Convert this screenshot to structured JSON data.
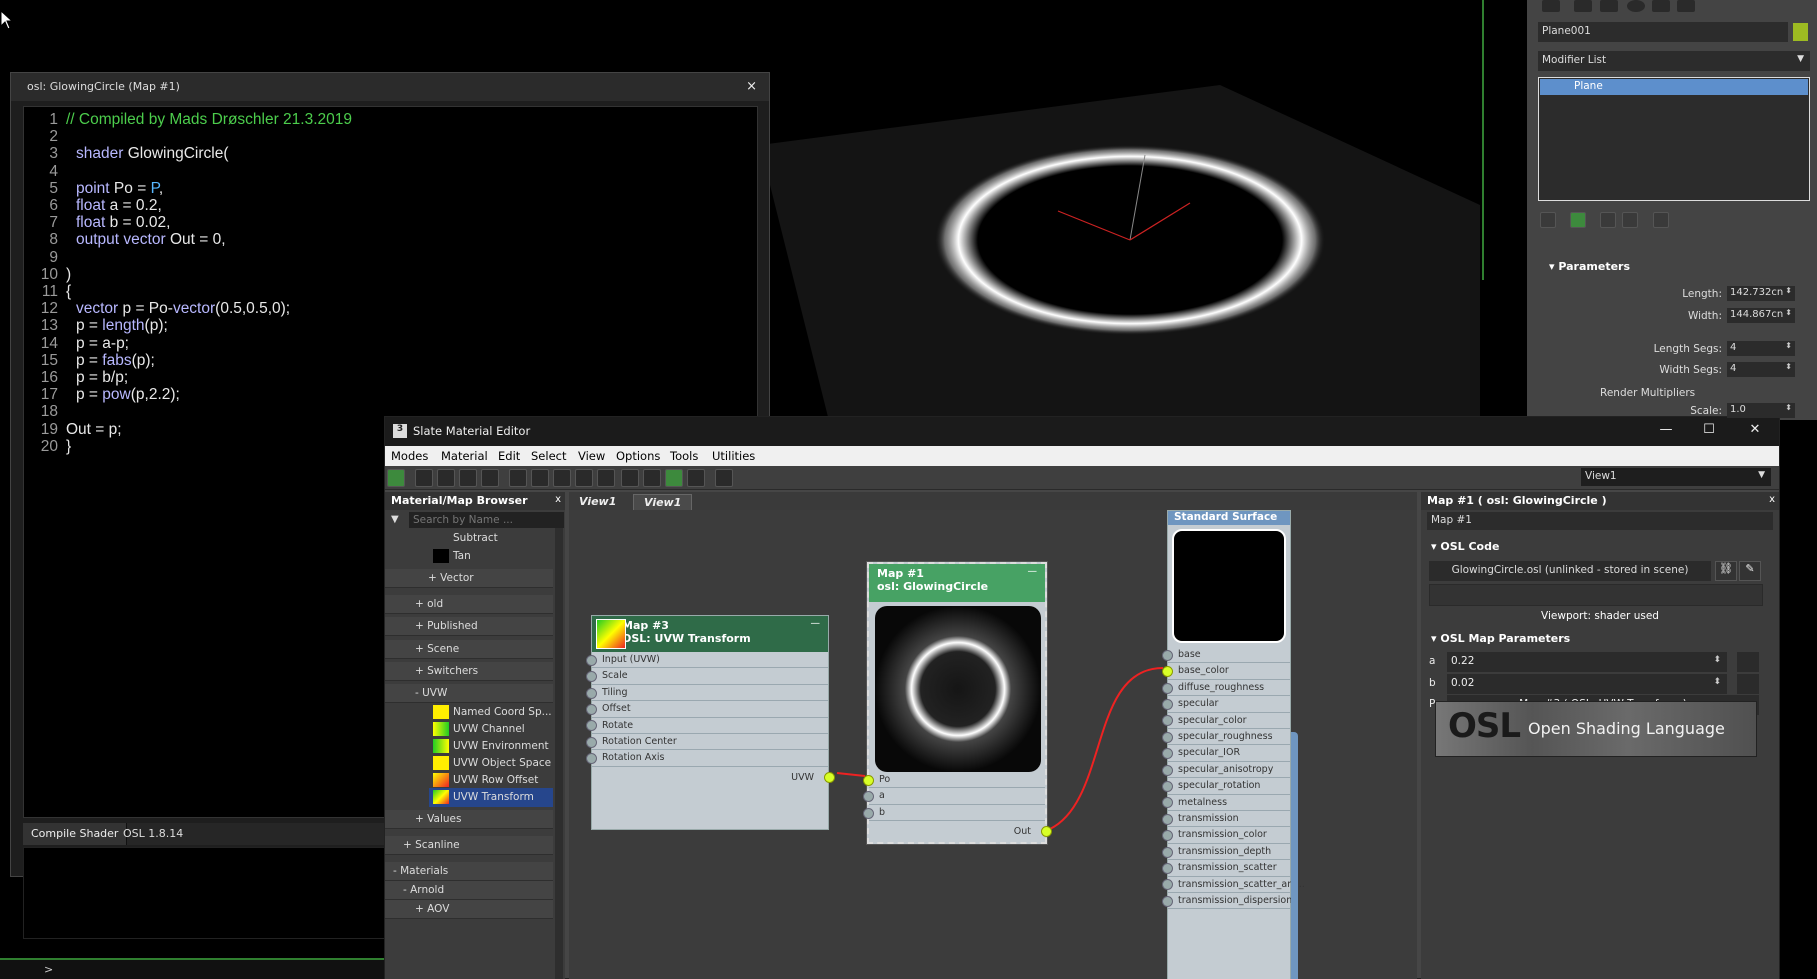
{
  "osl_editor": {
    "title": "osl: GlowingCircle (Map #1)",
    "close": "×",
    "lines": [
      {
        "n": "1",
        "t": "// Compiled by Mads Drøschler 21.3.2019"
      },
      {
        "n": "2",
        "t": ""
      },
      {
        "n": "3",
        "t": "shader GlowingCircle("
      },
      {
        "n": "4",
        "t": ""
      },
      {
        "n": "5",
        "t": "point Po = P,"
      },
      {
        "n": "6",
        "t": "float a = 0.2,"
      },
      {
        "n": "7",
        "t": "float b = 0.02,"
      },
      {
        "n": "8",
        "t": "output vector Out = 0,"
      },
      {
        "n": "9",
        "t": ""
      },
      {
        "n": "10",
        "t": ")"
      },
      {
        "n": "11",
        "t": "{"
      },
      {
        "n": "12",
        "t": "vector p = Po-vector(0.5,0.5,0);"
      },
      {
        "n": "13",
        "t": "p = length(p);"
      },
      {
        "n": "14",
        "t": "p = a-p;"
      },
      {
        "n": "15",
        "t": "p = fabs(p);"
      },
      {
        "n": "16",
        "t": "p = b/p;"
      },
      {
        "n": "17",
        "t": "p = pow(p,2.2);"
      },
      {
        "n": "18",
        "t": ""
      },
      {
        "n": "19",
        "t": "Out = p;"
      },
      {
        "n": "20",
        "t": "}"
      }
    ],
    "compile_label": "Compile Shader",
    "version": "OSL 1.8.14"
  },
  "command_panel": {
    "object_name": "Plane001",
    "modifier_list": "Modifier List",
    "stack_item": "Plane",
    "parameters_header": "Parameters",
    "length_label": "Length:",
    "length_value": "142.732cn",
    "width_label": "Width:",
    "width_value": "144.867cn",
    "length_segs_label": "Length Segs:",
    "length_segs_value": "4",
    "width_segs_label": "Width Segs:",
    "width_segs_value": "4",
    "render_multipliers": "Render Multipliers",
    "scale_label": "Scale:",
    "scale_value": "1.0",
    "colors": {
      "object_color": "#9dbb22",
      "selected": "#5d8fcc"
    }
  },
  "status": {
    "arrow": ">"
  },
  "slate": {
    "title": "Slate Material Editor",
    "app_icon": "3",
    "minimize": "—",
    "maximize": "☐",
    "close": "✕",
    "menu": [
      "Modes",
      "Material",
      "Edit",
      "Select",
      "View",
      "Options",
      "Tools",
      "Utilities"
    ],
    "view_select": "View1",
    "browser": {
      "header": "Material/Map Browser",
      "close": "x",
      "search_placeholder": "Search by Name ...",
      "items": {
        "subtract": "Subtract",
        "tan": "Tan",
        "vector": "+ Vector",
        "old": "+ old",
        "published": "+ Published",
        "scene": "+ Scene",
        "switchers": "+ Switchers",
        "uvw": "- UVW",
        "named_coord": "Named Coord Sp...",
        "uvw_channel": "UVW Channel",
        "uvw_environment": "UVW Environment",
        "uvw_object_space": "UVW Object Space",
        "uvw_row_offset": "UVW Row Offset",
        "uvw_transform": "UVW Transform",
        "values": "+ Values",
        "scanline": "+ Scanline",
        "materials": "- Materials",
        "arnold": "- Arnold",
        "aov": "+ AOV"
      }
    },
    "view_tabs": [
      "View1",
      "View1"
    ],
    "nodes": {
      "uvw": {
        "title1": "Map #3",
        "title2": "OSL: UVW Transform",
        "collapse": "—",
        "slots": [
          "Input (UVW)",
          "Scale",
          "Tiling",
          "Offset",
          "Rotate",
          "Rotation Center",
          "Rotation Axis"
        ],
        "out": "UVW",
        "color": "#2f6b48"
      },
      "glow": {
        "title1": "Map #1",
        "title2": "osl: GlowingCircle",
        "collapse": "—",
        "slots": [
          "Po",
          "a",
          "b"
        ],
        "out": "Out",
        "color": "#47a264"
      },
      "surface": {
        "title": "Standard Surface",
        "slots": [
          "base",
          "base_color",
          "diffuse_roughness",
          "specular",
          "specular_color",
          "specular_roughness",
          "specular_IOR",
          "specular_anisotropy",
          "specular_rotation",
          "metalness",
          "transmission",
          "transmission_color",
          "transmission_depth",
          "transmission_scatter",
          "transmission_scatter_ani...",
          "transmission_dispersion*"
        ],
        "color": "#6f96c0"
      }
    },
    "params": {
      "header": "Map #1  ( osl: GlowingCircle )",
      "close": "x",
      "name": "Map #1",
      "osl_code_header": "OSL Code",
      "osl_file": "GlowingCircle.osl (unlinked - stored in scene)",
      "viewport_status": "Viewport: shader used",
      "map_params_header": "OSL Map Parameters",
      "a_label": "a",
      "a_value": "0.22",
      "b_label": "b",
      "b_value": "0.02",
      "po_label": "Po",
      "po_value": "Map #3  ( OSL: UVW Transform )",
      "logo_text": "Open Shading Language",
      "logo_mark": "OSL"
    }
  }
}
